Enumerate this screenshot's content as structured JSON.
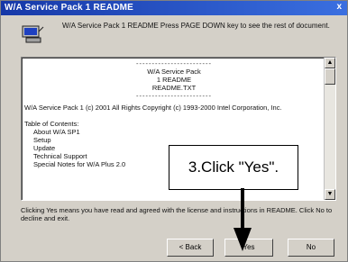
{
  "window": {
    "title": "W/A Service Pack 1 README",
    "close_label": "x"
  },
  "header": {
    "text": "W/A Service Pack 1 README  Press PAGE DOWN key to see the rest of document."
  },
  "readme": {
    "lines": [
      "------------------------",
      "W/A Service Pack",
      "1 README",
      "README.TXT",
      "------------------------",
      "W/A Service Pack 1 (c) 2001 All Rights Copyright (c) 1993-2000 Intel Corporation, Inc.",
      "",
      "Table of Contents:",
      "About W/A SP1",
      "Setup",
      "Update",
      "Technical Support",
      "Special Notes for W/A Plus 2.0"
    ]
  },
  "footer": {
    "text": "Clicking Yes means you have read and agreed with the license and instructions in README. Click No to decline and exit."
  },
  "buttons": {
    "back": "< Back",
    "yes": "Yes",
    "no": "No"
  },
  "callout": {
    "text": "3.Click \"Yes\"."
  },
  "scrollbar": {
    "up": "▲",
    "down": "▼"
  }
}
